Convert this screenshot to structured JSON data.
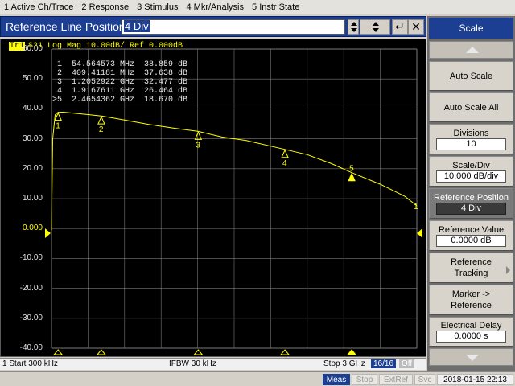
{
  "menubar": {
    "items": [
      "1 Active Ch/Trace",
      "2 Response",
      "3 Stimulus",
      "4 Mkr/Analysis",
      "5 Instr State"
    ]
  },
  "entry": {
    "label": "Reference Line Position",
    "value": "4 Div",
    "enter_glyph": "↵",
    "close_glyph": "✕"
  },
  "trace": {
    "badge": "Tr1",
    "header": "S21 Log Mag 10.00dB/ Ref 0.000dB",
    "color": "#ffff00"
  },
  "markers": [
    {
      "id": "1",
      "freq": "54.564573 MHz",
      "value": "38.859 dB"
    },
    {
      "id": "2",
      "freq": "409.41181 MHz",
      "value": "37.638 dB"
    },
    {
      "id": "3",
      "freq": "1.2052922 GHz",
      "value": "32.477 dB"
    },
    {
      "id": "4",
      "freq": "1.9167611 GHz",
      "value": "26.464 dB"
    },
    {
      "id": ">5",
      "freq": "2.4654362 GHz",
      "value": "18.670 dB"
    }
  ],
  "status": {
    "start": "1  Start 300 kHz",
    "ifbw": "IFBW 30 kHz",
    "stop": "Stop 3 GHz",
    "count": "16/16",
    "off": "Off"
  },
  "statusbar": {
    "meas": "Meas",
    "stop": "Stop",
    "extref": "ExtRef",
    "svc": "Svc",
    "datetime": "2018-01-15 22:13"
  },
  "softkeys": {
    "title": "Scale",
    "auto_scale": "Auto Scale",
    "auto_scale_all": "Auto Scale All",
    "divisions_label": "Divisions",
    "divisions_value": "10",
    "scale_div_label": "Scale/Div",
    "scale_div_value": "10.000 dB/div",
    "ref_pos_label": "Reference Position",
    "ref_pos_value": "4 Div",
    "ref_value_label": "Reference Value",
    "ref_value_value": "0.0000 dB",
    "ref_tracking_line1": "Reference",
    "ref_tracking_line2": "Tracking",
    "marker_ref_line1": "Marker ->",
    "marker_ref_line2": "Reference",
    "elec_delay_label": "Electrical Delay",
    "elec_delay_value": "0.0000 s"
  },
  "chart_data": {
    "type": "line",
    "ylim": [
      -40,
      60
    ],
    "xlim_hz": [
      300000,
      3000000000
    ],
    "y_ticks": [
      "60.00",
      "50.00",
      "40.00",
      "30.00",
      "20.00",
      "10.00",
      "0.000",
      "-10.00",
      "-20.00",
      "-30.00",
      "-40.00"
    ],
    "reference_value": 0,
    "grid": true,
    "trace_x_hz": [
      300000,
      10000000,
      30000000,
      54564573,
      100000000,
      200000000,
      300000000,
      409411810,
      600000000,
      800000000,
      1000000000,
      1205292200,
      1400000000,
      1600000000,
      1916761100,
      2100000000,
      2300000000,
      2465436200,
      2700000000,
      2900000000,
      3000000000
    ],
    "trace_y_db": [
      -0.5,
      30.0,
      38.0,
      38.86,
      38.9,
      38.5,
      38.1,
      37.64,
      36.3,
      34.8,
      33.6,
      32.48,
      30.6,
      29.4,
      26.46,
      24.7,
      21.7,
      18.67,
      14.8,
      10.8,
      7.6
    ],
    "markers_x_hz": [
      54564573,
      409411810,
      1205292200,
      1916761100,
      2465436200
    ],
    "markers_y_db": [
      38.859,
      37.638,
      32.477,
      26.464,
      18.67
    ],
    "marker_labels": [
      "1",
      "2",
      "3",
      "4",
      "5"
    ],
    "active_marker": "5",
    "end_label": "1"
  }
}
